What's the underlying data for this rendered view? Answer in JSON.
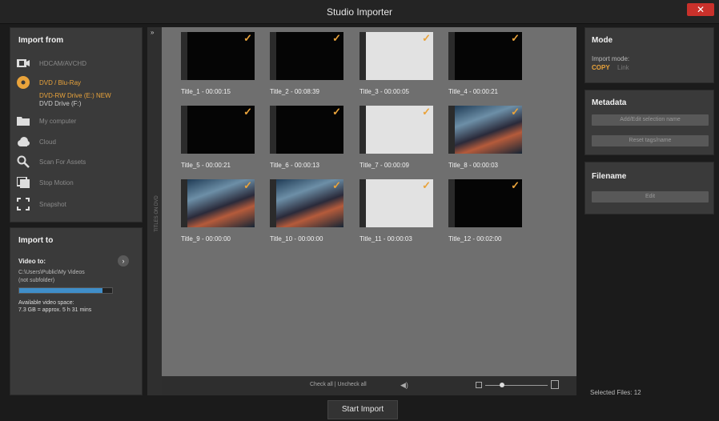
{
  "window": {
    "title": "Studio Importer",
    "close_icon": "close-icon"
  },
  "import_from": {
    "heading": "Import from",
    "items": [
      {
        "icon": "camcorder-icon",
        "label": "HDCAM/AVCHD"
      },
      {
        "icon": "disc-icon",
        "label": "DVD / Blu-Ray",
        "selected": true
      },
      {
        "icon": "folder-icon",
        "label": "My computer"
      },
      {
        "icon": "cloud-icon",
        "label": "Cloud"
      },
      {
        "icon": "search-icon",
        "label": "Scan For Assets"
      },
      {
        "icon": "stop-motion-icon",
        "label": "Stop Motion"
      },
      {
        "icon": "snapshot-icon",
        "label": "Snapshot"
      }
    ],
    "drive_label": "DVD-RW Drive (E:) NEW",
    "drive_sub": "DVD Drive (F:)"
  },
  "import_to": {
    "heading": "Import to",
    "video_label": "Video to:",
    "path": "C:\\Users\\Public\\My Videos",
    "sub": "(not subfolder)",
    "available_label": "Available video space:",
    "available_value": "7.3 GB = approx. 5 h 31 mins",
    "usage_fraction": 0.9
  },
  "titles": [
    {
      "label": "Title_1 - 00:00:15",
      "thumb": "black"
    },
    {
      "label": "Title_2 - 00:08:39",
      "thumb": "black"
    },
    {
      "label": "Title_3 - 00:00:05",
      "thumb": "white"
    },
    {
      "label": "Title_4 - 00:00:21",
      "thumb": "black"
    },
    {
      "label": "Title_5 - 00:00:21",
      "thumb": "black"
    },
    {
      "label": "Title_6 - 00:00:13",
      "thumb": "black"
    },
    {
      "label": "Title_7 - 00:00:09",
      "thumb": "white"
    },
    {
      "label": "Title_8 - 00:00:03",
      "thumb": "pic"
    },
    {
      "label": "Title_9 - 00:00:00",
      "thumb": "pic"
    },
    {
      "label": "Title_10 - 00:00:00",
      "thumb": "pic"
    },
    {
      "label": "Title_11 - 00:00:03",
      "thumb": "white"
    },
    {
      "label": "Title_12 - 00:02:00",
      "thumb": "black"
    }
  ],
  "strip_label": "TITLES ON DVD",
  "bottom_bar": {
    "check_all": "Check all | Uncheck all"
  },
  "mode": {
    "heading": "Mode",
    "import_mode_label": "Import mode:",
    "copy": "COPY",
    "link": "Link"
  },
  "metadata": {
    "heading": "Metadata",
    "btn1": "Add/Edit selection name",
    "btn2": "Reset tags/name"
  },
  "filename": {
    "heading": "Filename",
    "btn": "Edit"
  },
  "selected_files": "Selected Files: 12",
  "start_import": "Start Import",
  "accent": "#e9a33b",
  "progress_color": "#3f8ec9"
}
